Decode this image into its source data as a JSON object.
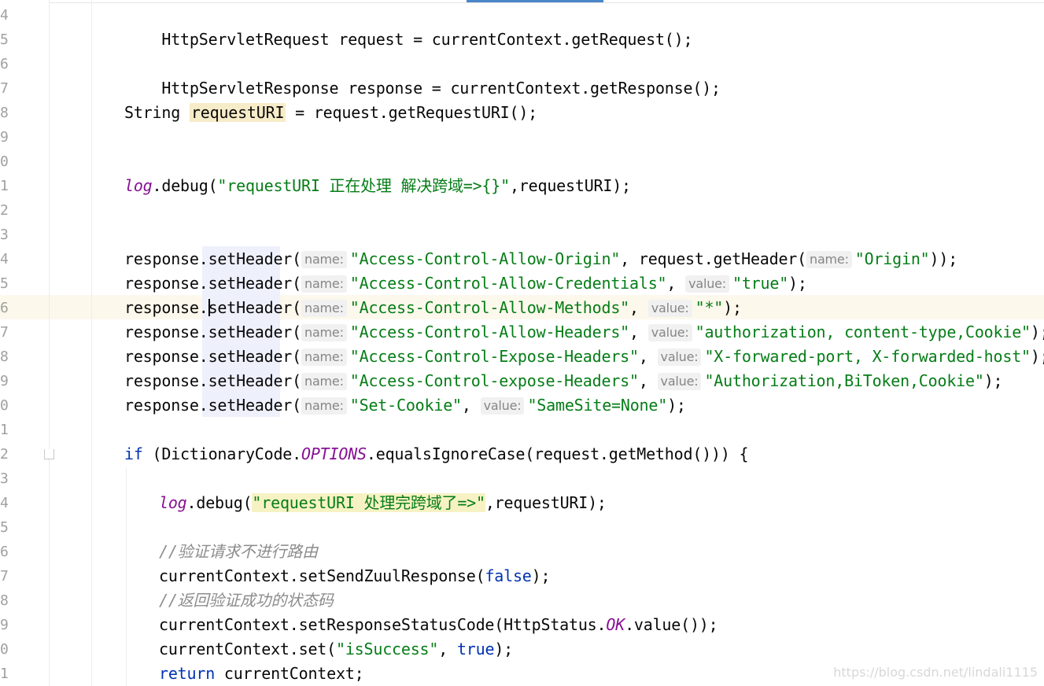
{
  "line_numbers": [
    "4",
    "5",
    "6",
    "7",
    "8",
    "9",
    "0",
    "1",
    "2",
    "3",
    "4",
    "5",
    "6",
    "7",
    "8",
    "9",
    "0",
    "1",
    "2",
    "3",
    "4",
    "5",
    "6",
    "7",
    "8",
    "9",
    "0",
    "1"
  ],
  "hints": {
    "name": "name:",
    "value": "value:"
  },
  "code": {
    "l1": "HttpServletRequest request = currentContext.getRequest();",
    "l3": "HttpServletResponse response = currentContext.getResponse();",
    "l5_a": "String ",
    "l5_var": "requestURI",
    "l5_b": " = request.getRequestURI();",
    "l8_log": "log",
    "l8_a": ".debug(",
    "l8_str": "\"requestURI 正在处理 解决跨域=>{}\"",
    "l8_b": ",requestURI);",
    "h1_a": "response.",
    "h1_m": "setHeader",
    "h1_p": "(",
    "h1_s1": "\"Access-Control-Allow-Origin\"",
    "h1_b": ", request.getHeader(",
    "h1_s2": "\"Origin\"",
    "h1_c": "));",
    "h2_s1": "\"Access-Control-Allow-Credentials\"",
    "h2_s2": "\"true\"",
    "h3_s1": "\"Access-Control-Allow-Methods\"",
    "h3_s2": "\"*\"",
    "h4_s1": "\"Access-Control-Allow-Headers\"",
    "h4_s2": "\"authorization, content-type,Cookie\"",
    "h5_s1": "\"Access-Control-Expose-Headers\"",
    "h5_s2": "\"X-forwared-port, X-forwarded-host\"",
    "h6_s1": "\"Access-Control-expose-Headers\"",
    "h6_s2": "\"Authorization,BiToken,Cookie\"",
    "h7_s1": "\"Set-Cookie\"",
    "h7_s2": "\"SameSite=None\"",
    "comma": ", ",
    "end": ");",
    "if_kw": "if",
    "if_a": " (DictionaryCode.",
    "if_fld": "OPTIONS",
    "if_b": ".equalsIgnoreCase(request.getMethod())) {",
    "log2_log": "log",
    "log2_a": ".debug(",
    "log2_str": "\"requestURI 处理完跨域了=>\"",
    "log2_b": ",requestURI);",
    "cmt1": "//验证请求不进行路由",
    "send_a": "currentContext.setSendZuulResponse(",
    "send_kw": "false",
    "send_b": ");",
    "cmt2": "//返回验证成功的状态码",
    "status_a": "currentContext.setResponseStatusCode(HttpStatus.",
    "status_fld": "OK",
    "status_b": ".value());",
    "set_a": "currentContext.set(",
    "set_str": "\"isSuccess\"",
    "set_comma": ", ",
    "set_kw": "true",
    "set_b": ");",
    "ret_kw": "return",
    "ret_b": " currentContext;"
  },
  "watermark": "https://blog.csdn.net/lindali1115"
}
